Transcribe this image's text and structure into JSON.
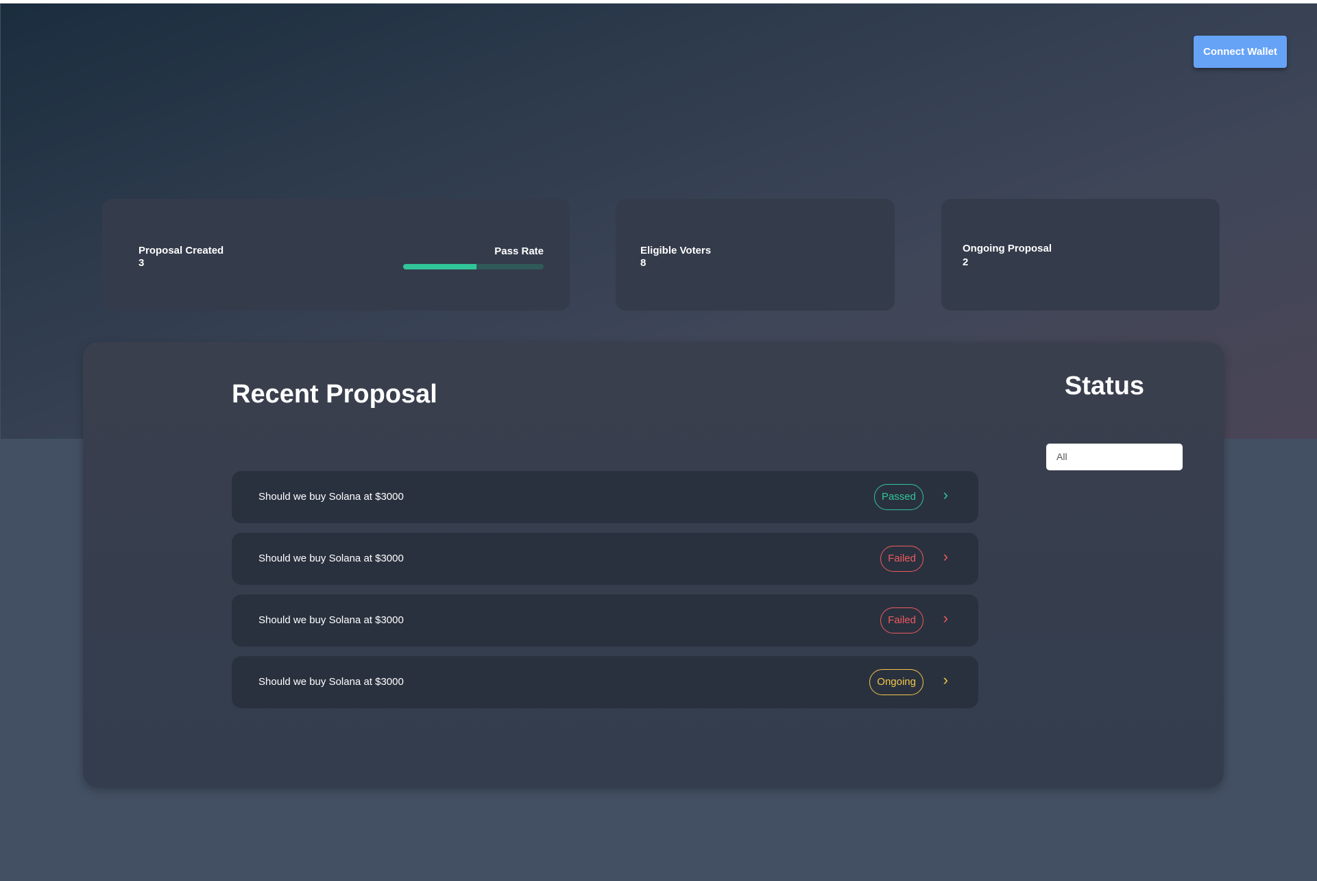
{
  "header": {
    "connect_wallet": "Connect Wallet"
  },
  "stats": {
    "proposal_created": {
      "label": "Proposal Created",
      "value": "3"
    },
    "pass_rate": {
      "label": "Pass Rate",
      "percent": 52
    },
    "eligible_voters": {
      "label": "Eligible Voters",
      "value": "8"
    },
    "ongoing_proposal": {
      "label": "Ongoing Proposal",
      "value": "2"
    }
  },
  "main": {
    "title": "Recent Proposal",
    "status_title": "Status",
    "status_filter": "All",
    "proposals": [
      {
        "title": "Should we buy Solana  at $3000",
        "status": "Passed"
      },
      {
        "title": "Should we buy Solana  at $3000",
        "status": "Failed"
      },
      {
        "title": "Should we buy Solana  at $3000",
        "status": "Failed"
      },
      {
        "title": "Should we buy Solana  at $3000",
        "status": "Ongoing"
      }
    ]
  },
  "colors": {
    "Passed": "#31c69a",
    "Failed": "#ef5a5f",
    "Ongoing": "#f1c74b",
    "accent": "#66a3f7"
  }
}
